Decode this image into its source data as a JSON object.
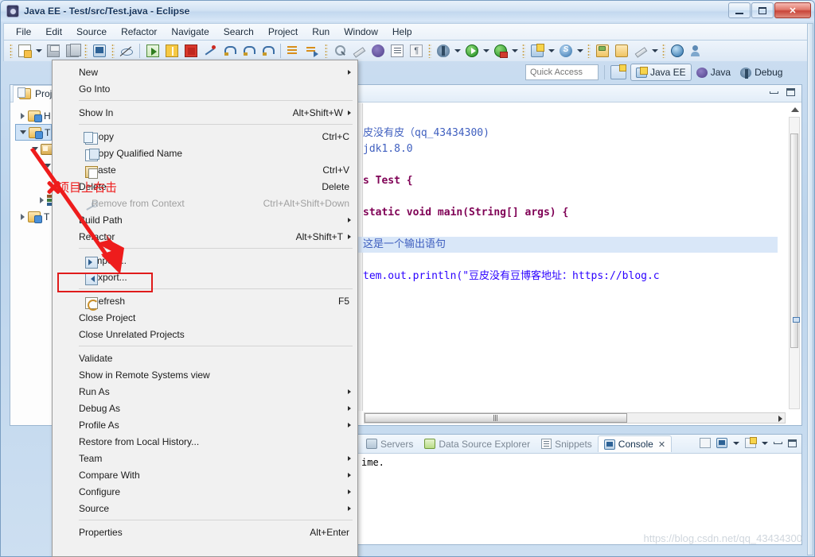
{
  "window": {
    "title": "Java EE - Test/src/Test.java - Eclipse",
    "app_icon": "eclipse-icon",
    "buttons": {
      "minimize": "minimize-button",
      "maximize": "maximize-button",
      "close": "close-button"
    }
  },
  "menubar": {
    "items": [
      "File",
      "Edit",
      "Source",
      "Refactor",
      "Navigate",
      "Search",
      "Project",
      "Run",
      "Window",
      "Help"
    ]
  },
  "toolbar": {
    "groups": [
      {
        "items": [
          {
            "name": "new-wizard-button",
            "icon": "new-document-icon",
            "dropdown": true
          },
          {
            "name": "save-button",
            "icon": "save-icon",
            "dropdown": false
          },
          {
            "name": "save-all-button",
            "icon": "save-all-icon",
            "dropdown": false
          }
        ]
      },
      {
        "items": [
          {
            "name": "open-terminal-button",
            "icon": "terminal-icon",
            "dropdown": false
          },
          {
            "name": "skip-breakpoints-button",
            "icon": "skip-breakpoints-icon",
            "dropdown": false
          }
        ]
      },
      {
        "items": [
          {
            "name": "resume-button",
            "icon": "resume-icon",
            "dropdown": false
          },
          {
            "name": "suspend-button",
            "icon": "suspend-icon",
            "dropdown": false
          },
          {
            "name": "terminate-button",
            "icon": "stop-icon",
            "dropdown": false
          },
          {
            "name": "disconnect-button",
            "icon": "disconnect-icon",
            "dropdown": false
          },
          {
            "name": "step-into-button",
            "icon": "step-into-icon",
            "dropdown": false
          },
          {
            "name": "step-over-button",
            "icon": "step-over-icon",
            "dropdown": false
          },
          {
            "name": "step-return-button",
            "icon": "step-return-icon",
            "dropdown": false
          }
        ]
      },
      {
        "items": [
          {
            "name": "next-annotation-button",
            "icon": "next-annotation-icon",
            "dropdown": false
          },
          {
            "name": "previous-annotation-button",
            "icon": "previous-annotation-icon",
            "dropdown": false
          }
        ]
      },
      {
        "items": [
          {
            "name": "open-type-button",
            "icon": "search-type-icon",
            "dropdown": false
          },
          {
            "name": "edit-button",
            "icon": "pencil-icon",
            "dropdown": false
          },
          {
            "name": "ejb-button",
            "icon": "bean-icon",
            "dropdown": false
          },
          {
            "name": "outline-list-button",
            "icon": "list-icon",
            "dropdown": false
          },
          {
            "name": "paragraph-button",
            "icon": "pilcrow-icon",
            "dropdown": false
          }
        ]
      },
      {
        "items": [
          {
            "name": "debug-button",
            "icon": "bug-icon",
            "dropdown": true
          },
          {
            "name": "run-button",
            "icon": "run-icon",
            "dropdown": true
          },
          {
            "name": "run-on-server-button",
            "icon": "run-server-icon",
            "dropdown": true
          }
        ]
      },
      {
        "items": [
          {
            "name": "new-wizard-2-button",
            "icon": "new-wizard-icon",
            "dropdown": true
          },
          {
            "name": "search-scope-button",
            "icon": "search-circle-icon",
            "dropdown": true
          }
        ]
      },
      {
        "items": [
          {
            "name": "open-task-button",
            "icon": "open-folder-icon",
            "dropdown": false
          },
          {
            "name": "close-task-button",
            "icon": "folder-icon",
            "dropdown": false
          },
          {
            "name": "annotate-button",
            "icon": "pencil-yellow-icon",
            "dropdown": true
          }
        ]
      },
      {
        "items": [
          {
            "name": "web-browser-button",
            "icon": "globe-icon",
            "dropdown": false
          },
          {
            "name": "run-last-tool-button",
            "icon": "person-run-icon",
            "dropdown": false
          }
        ]
      }
    ]
  },
  "quick_access": {
    "placeholder": "Quick Access",
    "value": "",
    "open_perspective_label": "open-perspective",
    "perspectives": [
      {
        "label": "Java EE",
        "icon": "javaee-perspective-icon",
        "active": true
      },
      {
        "label": "Java",
        "icon": "java-perspective-icon",
        "active": false
      },
      {
        "label": "Debug",
        "icon": "debug-perspective-icon",
        "active": false
      }
    ]
  },
  "project_explorer": {
    "tab_label": "Proje",
    "tab_icon": "project-explorer-icon",
    "tree": [
      {
        "label": "H",
        "icon": "project-folder-icon",
        "indent": 0,
        "twisty": "closed",
        "selected": false
      },
      {
        "label": "T",
        "icon": "project-folder-icon",
        "indent": 0,
        "twisty": "open",
        "selected": true
      },
      {
        "label": "",
        "icon": "package-folder-icon",
        "indent": 1,
        "twisty": "open",
        "selected": false
      },
      {
        "label": "",
        "icon": "package-icon",
        "indent": 2,
        "twisty": "open",
        "selected": false
      },
      {
        "label": "",
        "icon": "library-icon",
        "indent": 1,
        "twisty": "closed",
        "selected": false
      },
      {
        "label": "T",
        "icon": "project-folder-icon",
        "indent": 0,
        "twisty": "closed",
        "selected": false
      }
    ],
    "minimize_label": "minimize-view",
    "maximize_label": "maximize-view"
  },
  "editor": {
    "minimize_label": "minimize-view",
    "maximize_label": "maximize-view",
    "lines": [
      {
        "text": "皮没有皮（qq_43434300)",
        "style": "cmt",
        "highlight": false
      },
      {
        "text": "jdk1.8.0",
        "style": "cmt",
        "highlight": false
      },
      {
        "text": "",
        "style": "plain",
        "highlight": false
      },
      {
        "text": "s Test {",
        "style": "plain",
        "highlight": false
      },
      {
        "text": "",
        "style": "plain",
        "highlight": false
      },
      {
        "text": "static void main(String[] args) {",
        "style": "decl",
        "highlight": false
      },
      {
        "text": "",
        "style": "plain",
        "highlight": false
      },
      {
        "text": "这是一个输出语句",
        "style": "cmt",
        "highlight": true
      },
      {
        "text": "",
        "style": "plain",
        "highlight": false
      },
      {
        "text": "tem.out.println(\"豆皮没有豆博客地址：https://blog.c",
        "style": "code",
        "highlight": false
      }
    ]
  },
  "console_panel": {
    "tabs": [
      {
        "label": "Servers",
        "icon": "servers-icon",
        "active": false
      },
      {
        "label": "Data Source Explorer",
        "icon": "data-source-icon",
        "active": false
      },
      {
        "label": "Snippets",
        "icon": "snippets-icon",
        "active": false
      },
      {
        "label": "Console",
        "icon": "console-icon",
        "active": true,
        "closable": true
      }
    ],
    "close_glyph": "✕",
    "output": "ime.",
    "controls": [
      {
        "name": "pin-console-button",
        "icon": "pin-console-icon"
      },
      {
        "name": "display-selected-console-button",
        "icon": "display-console-icon",
        "dropdown": true
      },
      {
        "name": "open-console-button",
        "icon": "open-console-icon",
        "dropdown": true
      },
      {
        "name": "minimize-view-button",
        "icon": "minimize-icon"
      },
      {
        "name": "maximize-view-button",
        "icon": "maximize-icon"
      }
    ]
  },
  "context_menu": {
    "items": [
      {
        "label": "New",
        "accel": "",
        "submenu": true,
        "disabled": false,
        "icon": "",
        "separator_after": false
      },
      {
        "label": "Go Into",
        "accel": "",
        "submenu": false,
        "disabled": false,
        "icon": "",
        "separator_after": true
      },
      {
        "label": "Show In",
        "accel": "Alt+Shift+W",
        "submenu": true,
        "disabled": false,
        "icon": "",
        "separator_after": true
      },
      {
        "label": "Copy",
        "accel": "Ctrl+C",
        "submenu": false,
        "disabled": false,
        "icon": "copy-icon",
        "separator_after": false
      },
      {
        "label": "Copy Qualified Name",
        "accel": "",
        "submenu": false,
        "disabled": false,
        "icon": "copy-qualified-icon",
        "separator_after": false
      },
      {
        "label": "Paste",
        "accel": "Ctrl+V",
        "submenu": false,
        "disabled": false,
        "icon": "paste-icon",
        "separator_after": false
      },
      {
        "label": "Delete",
        "accel": "Delete",
        "submenu": false,
        "disabled": false,
        "icon": "",
        "separator_after": false
      },
      {
        "label": "Remove from Context",
        "accel": "Ctrl+Alt+Shift+Down",
        "submenu": false,
        "disabled": true,
        "icon": "remove-context-icon",
        "separator_after": false
      },
      {
        "label": "Build Path",
        "accel": "",
        "submenu": true,
        "disabled": false,
        "icon": "",
        "separator_after": false
      },
      {
        "label": "Refactor",
        "accel": "Alt+Shift+T",
        "submenu": true,
        "disabled": false,
        "icon": "",
        "separator_after": true
      },
      {
        "label": "Import...",
        "accel": "",
        "submenu": false,
        "disabled": false,
        "icon": "import-icon",
        "separator_after": false
      },
      {
        "label": "Export...",
        "accel": "",
        "submenu": false,
        "disabled": false,
        "icon": "export-icon",
        "separator_after": true
      },
      {
        "label": "Refresh",
        "accel": "F5",
        "submenu": false,
        "disabled": false,
        "icon": "refresh-icon",
        "separator_after": false
      },
      {
        "label": "Close Project",
        "accel": "",
        "submenu": false,
        "disabled": false,
        "icon": "",
        "separator_after": false
      },
      {
        "label": "Close Unrelated Projects",
        "accel": "",
        "submenu": false,
        "disabled": false,
        "icon": "",
        "separator_after": true
      },
      {
        "label": "Validate",
        "accel": "",
        "submenu": false,
        "disabled": false,
        "icon": "",
        "separator_after": false
      },
      {
        "label": "Show in Remote Systems view",
        "accel": "",
        "submenu": false,
        "disabled": false,
        "icon": "",
        "separator_after": false
      },
      {
        "label": "Run As",
        "accel": "",
        "submenu": true,
        "disabled": false,
        "icon": "",
        "separator_after": false
      },
      {
        "label": "Debug As",
        "accel": "",
        "submenu": true,
        "disabled": false,
        "icon": "",
        "separator_after": false
      },
      {
        "label": "Profile As",
        "accel": "",
        "submenu": true,
        "disabled": false,
        "icon": "",
        "separator_after": false
      },
      {
        "label": "Restore from Local History...",
        "accel": "",
        "submenu": false,
        "disabled": false,
        "icon": "",
        "separator_after": false
      },
      {
        "label": "Team",
        "accel": "",
        "submenu": true,
        "disabled": false,
        "icon": "",
        "separator_after": false
      },
      {
        "label": "Compare With",
        "accel": "",
        "submenu": true,
        "disabled": false,
        "icon": "",
        "separator_after": false
      },
      {
        "label": "Configure",
        "accel": "",
        "submenu": true,
        "disabled": false,
        "icon": "",
        "separator_after": false
      },
      {
        "label": "Source",
        "accel": "",
        "submenu": true,
        "disabled": false,
        "icon": "",
        "separator_after": true
      },
      {
        "label": "Properties",
        "accel": "Alt+Enter",
        "submenu": false,
        "disabled": false,
        "icon": "",
        "separator_after": false
      }
    ]
  },
  "annotations": {
    "note_text": "项目上右击",
    "note_color": "#ee1c1c",
    "highlight_color": "#e01b1b",
    "arrow_color": "#ee1c1c",
    "x_marker": "x-marker-icon"
  },
  "watermark": {
    "text": "https://blog.csdn.net/qq_43434300"
  }
}
